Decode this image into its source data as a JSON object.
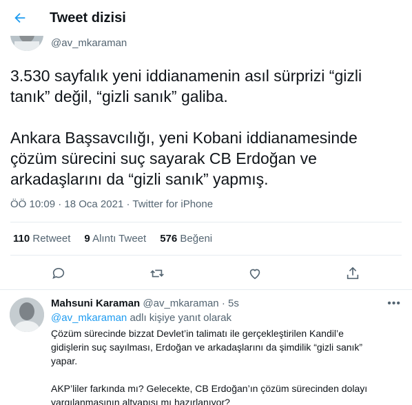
{
  "header": {
    "title": "Tweet dizisi"
  },
  "author": {
    "handle": "@av_mkaraman"
  },
  "tweet": {
    "text": "3.530 sayfalık yeni iddianamenin asıl sürprizi “gizli tanık” değil, “gizli sanık” galiba.\n\nAnkara Başsavcılığı, yeni Kobani iddianamesinde çözüm sürecini suç sayarak CB Erdoğan ve arkadaşlarını da “gizli sanık” yapmış.",
    "time": "ÖÖ 10:09",
    "separator": " · ",
    "date": "18 Oca 2021",
    "client": "Twitter for iPhone"
  },
  "stats": {
    "retweets_count": "110",
    "retweets_label": "Retweet",
    "quotes_count": "9",
    "quotes_label": "Alıntı Tweet",
    "likes_count": "576",
    "likes_label": "Beğeni"
  },
  "actions": [
    "reply-icon",
    "retweet-icon",
    "like-icon",
    "share-icon"
  ],
  "reply": {
    "name": "Mahsuni Karaman",
    "handle": "@av_mkaraman",
    "dot": " · ",
    "time": "5s",
    "replying_mention": "@av_mkaraman",
    "replying_suffix": " adlı kişiye yanıt olarak",
    "paragraph1": "Çözüm sürecinde bizzat Devlet’in talimatı ile gerçekleştirilen Kandil’e gidişlerin suç sayılması, Erdoğan ve arkadaşlarını da şimdilik “gizli sanık” yapar.",
    "paragraph2": "AKP’liler farkında mı? Gelecekte, CB Erdoğan’ın çözüm sürecinden dolayı yargılanmasının altyapısı mı hazırlanıyor?"
  },
  "colors": {
    "accent": "#1d9bf0",
    "muted": "#536471",
    "text": "#0f1419",
    "border": "#e6ecf0"
  }
}
